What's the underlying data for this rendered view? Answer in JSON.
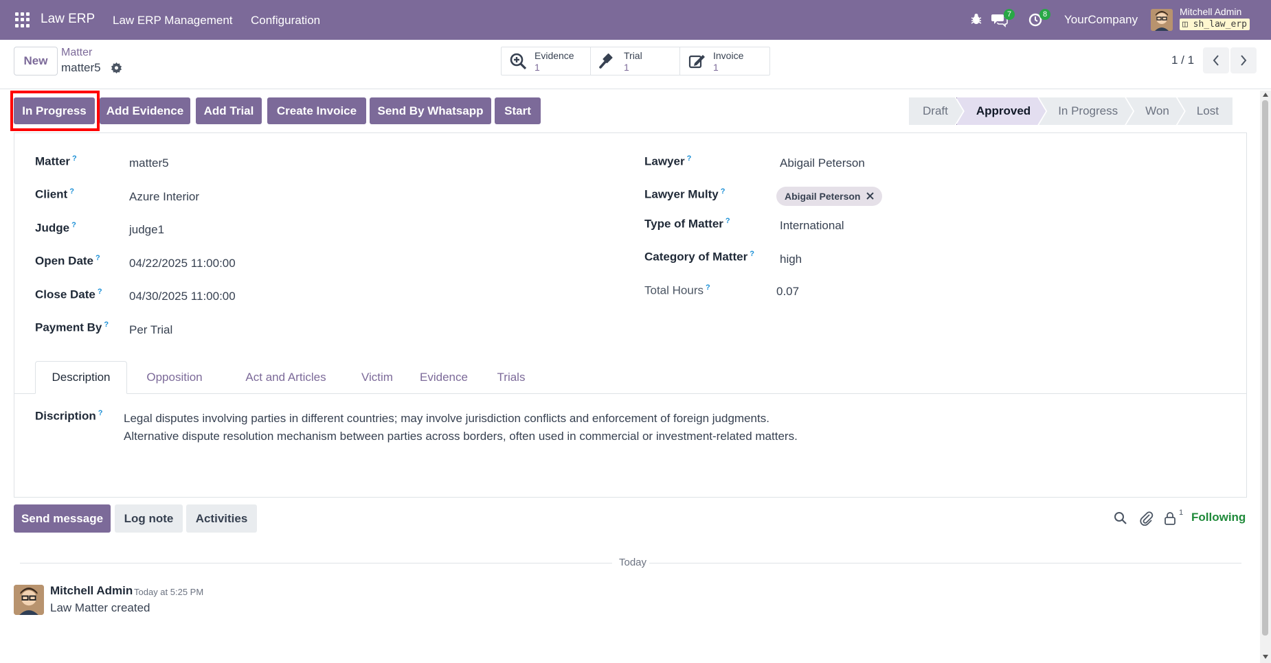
{
  "navbar": {
    "brand": "Law ERP",
    "menus": [
      "Law ERP Management",
      "Configuration"
    ],
    "messages_count": "7",
    "activities_count": "8",
    "company": "YourCompany",
    "user_name": "Mitchell Admin",
    "database": "sh_law_erp"
  },
  "control_panel": {
    "new_label": "New",
    "breadcrumb_parent": "Matter",
    "breadcrumb_current": "matter5",
    "smart_buttons": [
      {
        "label": "Evidence",
        "value": "1",
        "icon": "search-plus-icon"
      },
      {
        "label": "Trial",
        "value": "1",
        "icon": "gavel-icon"
      },
      {
        "label": "Invoice",
        "value": "1",
        "icon": "edit-icon"
      }
    ],
    "pager": "1 / 1"
  },
  "actions": [
    {
      "label": "In Progress"
    },
    {
      "label": "Add Evidence"
    },
    {
      "label": "Add Trial"
    },
    {
      "label": "Create Invoice"
    },
    {
      "label": "Send By Whatsapp"
    },
    {
      "label": "Start"
    }
  ],
  "statusbar": {
    "stages": [
      "Draft",
      "Approved",
      "In Progress",
      "Won",
      "Lost"
    ],
    "active": "Approved"
  },
  "form": {
    "left": [
      {
        "label": "Matter",
        "value": "matter5"
      },
      {
        "label": "Client",
        "value": "Azure Interior"
      },
      {
        "label": "Judge",
        "value": "judge1"
      },
      {
        "label": "Open Date",
        "value": "04/22/2025 11:00:00"
      },
      {
        "label": "Close Date",
        "value": "04/30/2025 11:00:00"
      },
      {
        "label": "Payment By",
        "value": "Per Trial"
      }
    ],
    "right": [
      {
        "label": "Lawyer",
        "value": "Abigail Peterson"
      },
      {
        "label": "Lawyer Multy",
        "value": "Abigail Peterson"
      },
      {
        "label": "Type of Matter",
        "value": "International"
      },
      {
        "label": "Category of Matter",
        "value": "high"
      },
      {
        "label": "Total Hours",
        "value": "0.07"
      }
    ],
    "help_mark": "?"
  },
  "tabs": [
    "Description",
    "Opposition",
    "Act and Articles",
    "Victim",
    "Evidence",
    "Trials"
  ],
  "description": {
    "label": "Discription",
    "lines": [
      "Legal disputes involving parties in different countries; may involve jurisdiction conflicts and enforcement of foreign judgments.",
      "Alternative dispute resolution mechanism between parties across borders, often used in commercial or investment-related matters."
    ]
  },
  "chatter": {
    "send_message": "Send message",
    "log_note": "Log note",
    "activities": "Activities",
    "followers_count": "1",
    "following": "Following",
    "date_separator": "Today",
    "messages": [
      {
        "author": "Mitchell Admin",
        "time": "Today at 5:25 PM",
        "body": "Law Matter created"
      }
    ]
  },
  "colors": {
    "brand": "#7c6a99",
    "highlight": "#ff0000",
    "following": "#1f8a3a",
    "badge": "#28a745"
  }
}
